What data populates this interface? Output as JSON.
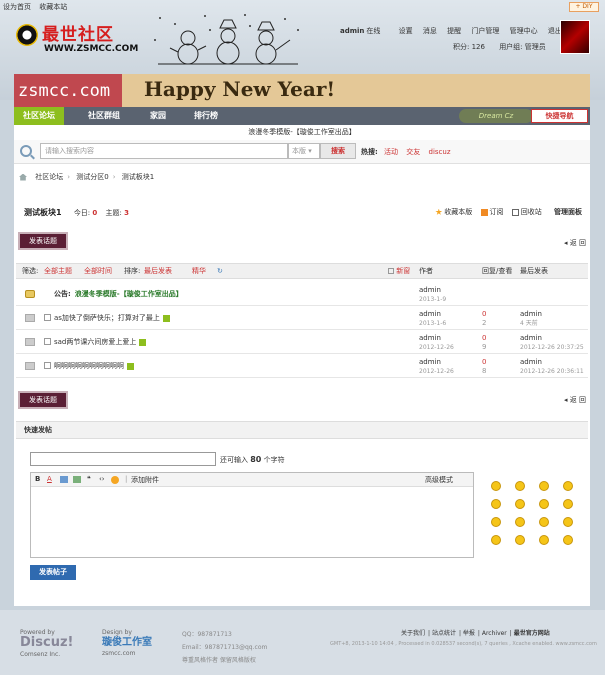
{
  "topbar": {
    "set_home": "设为首页",
    "bookmark": "收藏本站",
    "diy": "+ DIY"
  },
  "logo": {
    "name": "最世社区",
    "url": "WWW.ZSMCC.COM"
  },
  "user": {
    "username": "admin",
    "status": "在线",
    "links": [
      "设置",
      "消息",
      "提醒",
      "门户管理",
      "管理中心",
      "退出"
    ],
    "points": "积分: 126",
    "group": "用户组: 管理员"
  },
  "banner": {
    "left": "zsmcc.com",
    "center": "Happy New Year!"
  },
  "nav": {
    "items": [
      "社区论坛",
      "社区群组",
      "家园",
      "排行榜"
    ],
    "deco": "Dream Cz",
    "quick": "快捷导航"
  },
  "notice": "浪漫冬季模版-【璇俊工作室出品】",
  "search": {
    "placeholder": "请输入搜索内容",
    "scope": "本版",
    "button": "搜索",
    "hot_label": "热搜:",
    "hot": [
      "活动",
      "交友",
      "discuz"
    ]
  },
  "breadcrumb": [
    "社区论坛",
    "测试分区0",
    "测试板块1"
  ],
  "forum": {
    "name": "测试板块1",
    "today_label": "今日:",
    "today": "0",
    "topics_label": "主题:",
    "topics": "3",
    "tools": {
      "fav": "收藏本版",
      "rss": "订阅",
      "recycle": "回收站",
      "admin": "管理面板"
    }
  },
  "post_button": "发表话题",
  "back": "返 回",
  "filter": {
    "label": "筛选:",
    "all": "全部主题",
    "time": "全部时间",
    "sort_label": "排序:",
    "sort": "最后发表",
    "digest": "精华",
    "newwin": "新窗",
    "col_author": "作者",
    "col_reply": "回复/查看",
    "col_last": "最后发表"
  },
  "announcement": {
    "prefix": "公告:",
    "title": "浪漫冬季模版-【璇俊工作室出品】",
    "author": "admin",
    "date": "2013-1-9"
  },
  "threads": [
    {
      "title": "as加快了倒萨快乐；打算对了最上",
      "author": "admin",
      "date": "2013-1-6",
      "replies": "0",
      "views": "2",
      "last_user": "admin",
      "last_time": "4 天前"
    },
    {
      "title": "sad两节课六间房爱上爱上",
      "author": "admin",
      "date": "2012-12-26",
      "replies": "0",
      "views": "9",
      "last_user": "admin",
      "last_time": "2012-12-26 20:37:25"
    },
    {
      "title": "啊啊啊啊啊啊啊啊啊啊",
      "author": "admin",
      "date": "2012-12-26",
      "replies": "0",
      "views": "8",
      "last_user": "admin",
      "last_time": "2012-12-26 20:36:11"
    }
  ],
  "quickpost": {
    "title": "快速发帖",
    "remain_prefix": "还可输入",
    "remain_num": "80",
    "remain_suffix": "个字符",
    "toolbar": [
      "B",
      "A",
      "添加附件",
      "高级模式"
    ],
    "submit": "发表帖子"
  },
  "footer": {
    "powered_by": "Powered by",
    "discuz": "Discuz!",
    "comsenz": "Comsenz Inc.",
    "design_by": "Design by",
    "studio": "璇俊工作室",
    "studio_url": "zsmcc.com",
    "qq": "QQ：987871713",
    "email": "Email：987871713@qq.com",
    "tags": "尊重风格作者  保留风格版权",
    "links": [
      "关于我们",
      "站点统计",
      "举报",
      "Archiver",
      "最世官方网站"
    ],
    "gmt": "GMT+8, 2013-1-10 14:04 , Processed in 0.028537 second(s), 7 queries , Xcache enabled.  www.zsmcc.com"
  },
  "colors": {
    "nav_active": "#8dbe1e",
    "post_button": "#5b1f35",
    "link_red": "#cc3333",
    "submit": "#2f6ab0"
  }
}
